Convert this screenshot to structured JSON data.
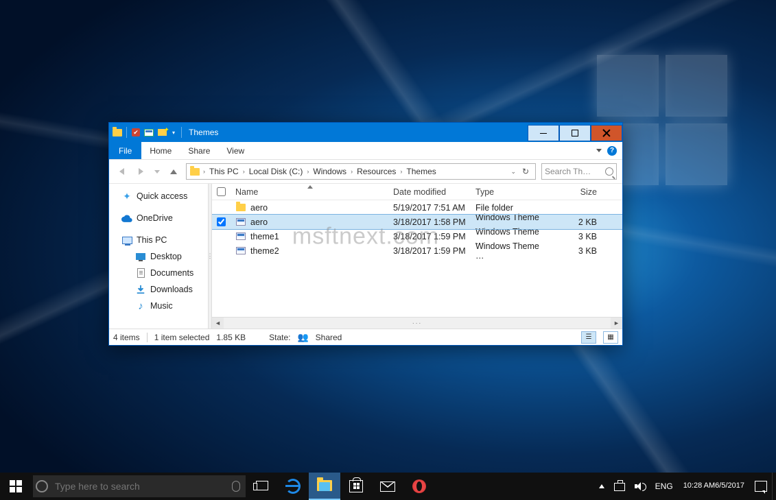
{
  "watermark": "msftnext.com",
  "titlebar": {
    "title": "Themes"
  },
  "window_buttons": {
    "minimize": "Minimize",
    "maximize": "Maximize",
    "close": "Close"
  },
  "ribbon": {
    "file": "File",
    "tabs": [
      "Home",
      "Share",
      "View"
    ]
  },
  "address": {
    "segments": [
      "This PC",
      "Local Disk (C:)",
      "Windows",
      "Resources",
      "Themes"
    ],
    "search_placeholder": "Search Th…"
  },
  "navpane": {
    "quick_access": "Quick access",
    "onedrive": "OneDrive",
    "this_pc": "This PC",
    "children": [
      "Desktop",
      "Documents",
      "Downloads",
      "Music"
    ]
  },
  "columns": {
    "name": "Name",
    "date": "Date modified",
    "type": "Type",
    "size": "Size"
  },
  "rows": [
    {
      "name": "aero",
      "date": "5/19/2017 7:51 AM",
      "type": "File folder",
      "size": "",
      "kind": "folder",
      "selected": false
    },
    {
      "name": "aero",
      "date": "3/18/2017 1:58 PM",
      "type": "Windows Theme …",
      "size": "2 KB",
      "kind": "theme",
      "selected": true
    },
    {
      "name": "theme1",
      "date": "3/18/2017 1:59 PM",
      "type": "Windows Theme …",
      "size": "3 KB",
      "kind": "theme",
      "selected": false
    },
    {
      "name": "theme2",
      "date": "3/18/2017 1:59 PM",
      "type": "Windows Theme …",
      "size": "3 KB",
      "kind": "theme",
      "selected": false
    }
  ],
  "status": {
    "count": "4 items",
    "selection": "1 item selected",
    "sel_size": "1.85 KB",
    "state_label": "State:",
    "state_value": "Shared"
  },
  "taskbar": {
    "search_placeholder": "Type here to search",
    "lang": "ENG",
    "time": "10:28 AM",
    "date": "6/5/2017"
  }
}
